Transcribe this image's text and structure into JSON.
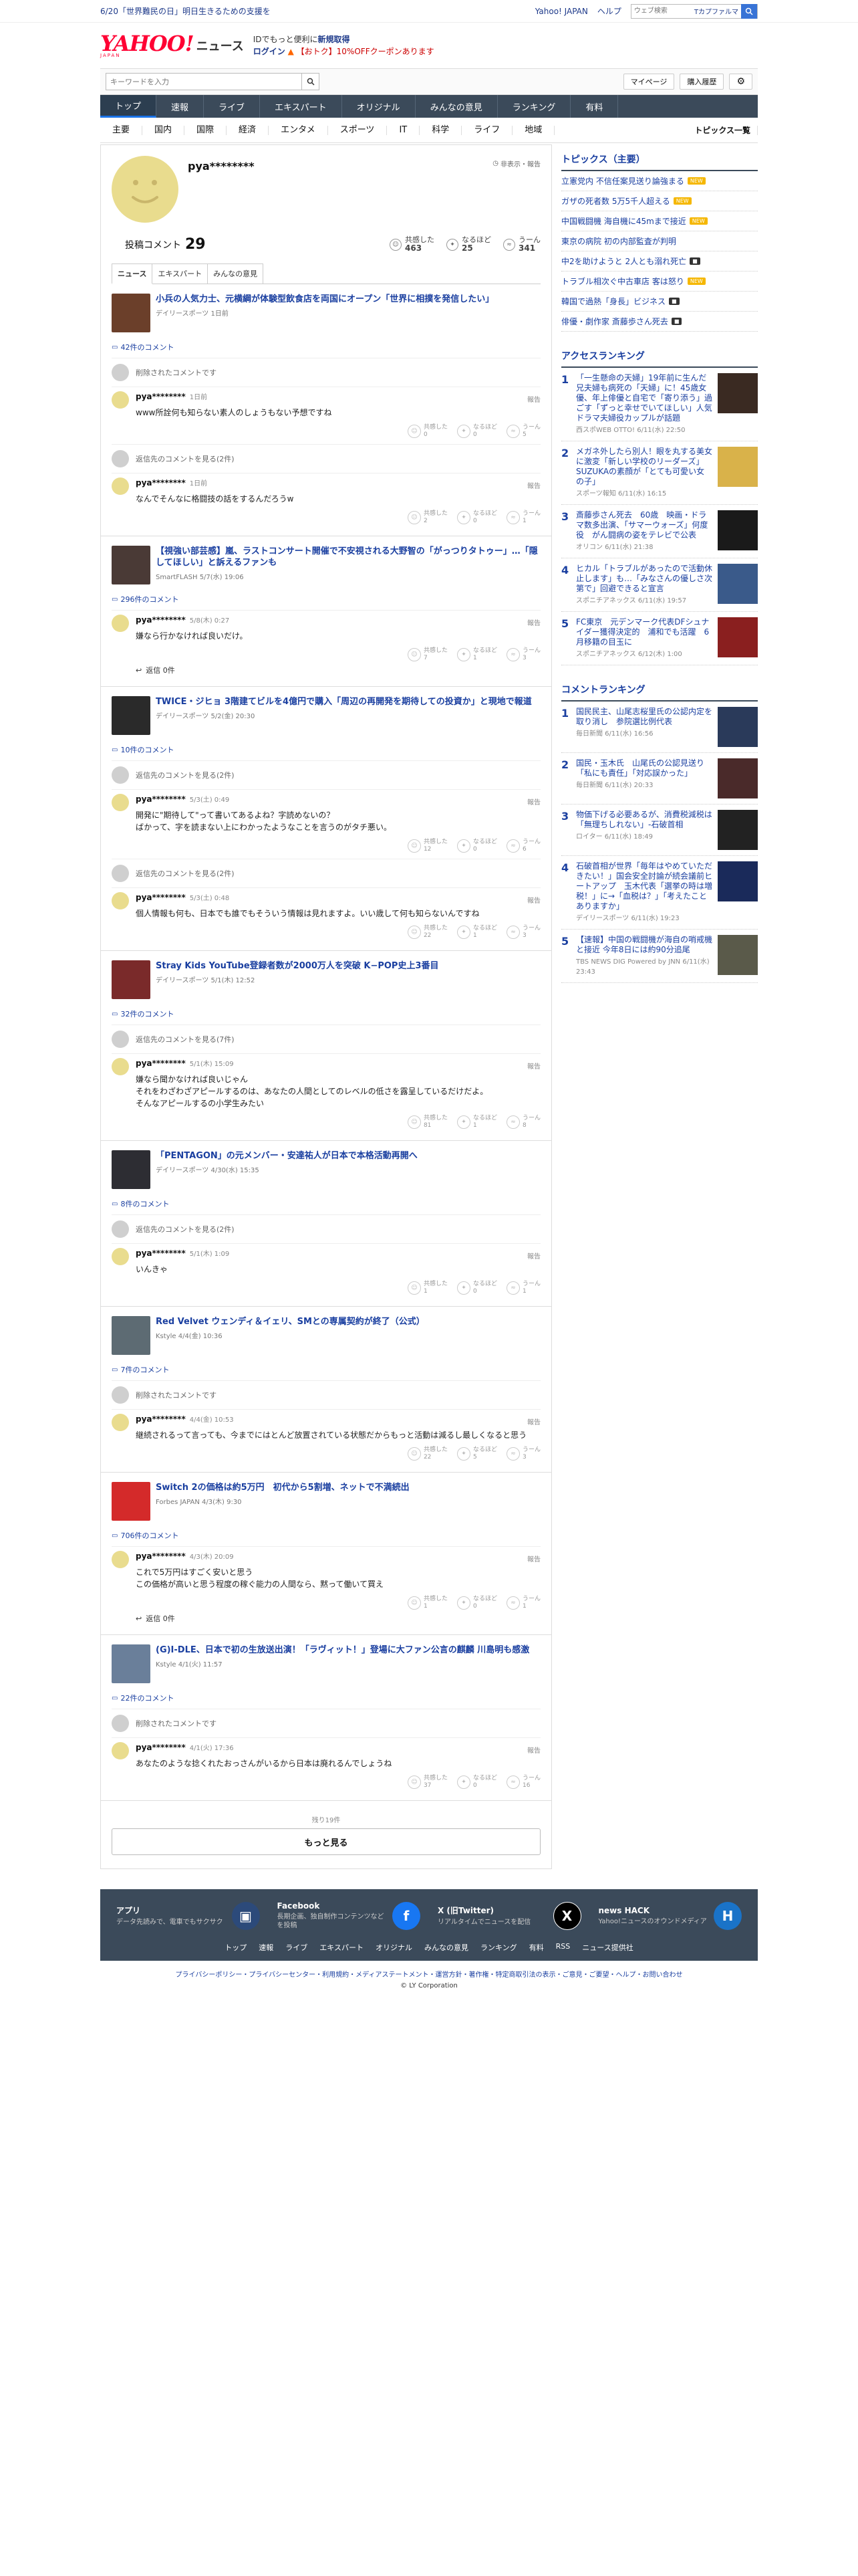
{
  "topbar": {
    "promo": "6/20「世界難民の日」明日生きるための支援を",
    "links": [
      "Yahoo! JAPAN",
      "ヘルプ"
    ],
    "search_placeholder": "ウェブ検索",
    "search_button": "Tカプファルマ"
  },
  "header": {
    "logo_yahoo": "YAHOO!",
    "logo_japan": "JAPAN",
    "logo_news": "ニュース",
    "msg1_a": "IDでもっと便利に",
    "msg1_b": "新規取得",
    "msg2_a": "ログイン",
    "msg2_b": "【おトク】10%OFFクーポンあります"
  },
  "searchbar": {
    "placeholder": "キーワードを入力",
    "mypage": "マイページ",
    "history": "購入履歴"
  },
  "gnav": [
    "トップ",
    "速報",
    "ライブ",
    "エキスパート",
    "オリジナル",
    "みんなの意見",
    "ランキング",
    "有料"
  ],
  "snav": [
    "主要",
    "国内",
    "国際",
    "経済",
    "エンタメ",
    "スポーツ",
    "IT",
    "科学",
    "ライフ",
    "地域"
  ],
  "snav_list": "トピックス一覧",
  "profile": {
    "name": "pya********",
    "hidden_note": "非表示・報告",
    "count_label": "投稿コメント",
    "count": "29",
    "reactions": [
      {
        "label": "共感した",
        "value": "463",
        "icon": "thumbs-up-icon"
      },
      {
        "label": "なるほど",
        "value": "25",
        "icon": "lightbulb-icon"
      },
      {
        "label": "うーん",
        "value": "341",
        "icon": "hmm-icon"
      }
    ]
  },
  "tabs": [
    "ニュース",
    "エキスパート",
    "みんなの意見"
  ],
  "articles": [
    {
      "title": "小兵の人気力士、元横綱が体験型飲食店を両国にオープン「世界に相撲を発信したい」",
      "source": "デイリースポーツ 1日前",
      "thumb_color": "#6b3f2a",
      "count": "42件のコメント",
      "comments": [
        {
          "type": "deleted",
          "text": "削除されたコメントです"
        },
        {
          "type": "comment",
          "user": "pya********",
          "time": "1日前",
          "text": "www所詮何も知らない素人のしょうもない予想ですね",
          "r": [
            "0",
            "0",
            "5"
          ]
        },
        {
          "type": "deleted",
          "text": "返信先のコメントを見る(2件)"
        },
        {
          "type": "comment",
          "user": "pya********",
          "time": "1日前",
          "text": "なんでそんなに格闘技の話をするんだろうw",
          "r": [
            "2",
            "0",
            "1"
          ]
        }
      ]
    },
    {
      "title": "【視強い部芸感】嵐、ラストコンサート開催で不安視される大野智の「がっつりタトゥー」…「隠してほしい」と訴えるファンも",
      "source": "SmartFLASH 5/7(水) 19:06",
      "thumb_color": "#4a3a36",
      "count": "296件のコメント",
      "comments": [
        {
          "type": "comment",
          "user": "pya********",
          "time": "5/8(木) 0:27",
          "text": "嫌なら行かなければ良いだけ。",
          "r": [
            "7",
            "1",
            "3"
          ],
          "reply": "返信 0件"
        }
      ]
    },
    {
      "title": "TWICE・ジヒョ 3階建てビルを4億円で購入「周辺の再開発を期待しての投資か」と現地で報道",
      "source": "デイリースポーツ 5/2(金) 20:30",
      "thumb_color": "#2a2a2a",
      "count": "10件のコメント",
      "comments": [
        {
          "type": "deleted",
          "text": "返信先のコメントを見る(2件)"
        },
        {
          "type": "comment",
          "user": "pya********",
          "time": "5/3(土) 0:49",
          "text": "開発に\"期待して\"って書いてあるよね？字読めないの？\nばかって、字を読まない上にわかったようなことを言うのがタチ悪い。",
          "r": [
            "12",
            "0",
            "6"
          ]
        },
        {
          "type": "deleted",
          "text": "返信先のコメントを見る(2件)"
        },
        {
          "type": "comment",
          "user": "pya********",
          "time": "5/3(土) 0:48",
          "text": "個人情報も何も、日本でも誰でもそういう情報は見れますよ。いい歳して何も知らないんですね",
          "r": [
            "22",
            "1",
            "3"
          ]
        }
      ]
    },
    {
      "title": "Stray Kids YouTube登録者数が2000万人を突破 K−POP史上3番目",
      "source": "デイリースポーツ 5/1(木) 12:52",
      "thumb_color": "#7a2a2a",
      "count": "32件のコメント",
      "comments": [
        {
          "type": "deleted",
          "text": "返信先のコメントを見る(7件)"
        },
        {
          "type": "comment",
          "user": "pya********",
          "time": "5/1(木) 15:09",
          "text": "嫌なら聞かなければ良いじゃん\nそれをわざわざアピールするのは、あなたの人間としてのレベルの低さを露呈しているだけだよ。\nそんなアピールするの小学生みたい",
          "r": [
            "81",
            "1",
            "8"
          ]
        }
      ]
    },
    {
      "title": "「PENTAGON」の元メンバー・安達祐人が日本で本格活動再開へ",
      "source": "デイリースポーツ 4/30(水) 15:35",
      "thumb_color": "#2d2d33",
      "count": "8件のコメント",
      "comments": [
        {
          "type": "deleted",
          "text": "返信先のコメントを見る(2件)"
        },
        {
          "type": "comment",
          "user": "pya********",
          "time": "5/1(木) 1:09",
          "text": "いんきゃ",
          "r": [
            "1",
            "0",
            "1"
          ]
        }
      ]
    },
    {
      "title": "Red Velvet ウェンディ＆イェリ、SMとの専属契約が終了（公式）",
      "source": "Kstyle 4/4(金) 10:36",
      "thumb_color": "#5d6b73",
      "count": "7件のコメント",
      "comments": [
        {
          "type": "deleted",
          "text": "削除されたコメントです"
        },
        {
          "type": "comment",
          "user": "pya********",
          "time": "4/4(金) 10:53",
          "text": "継続されるって言っても、今までにはとんど放置されている状態だからもっと活動は減るし最しくなると思う",
          "r": [
            "22",
            "5",
            "3"
          ]
        }
      ]
    },
    {
      "title": "Switch 2の価格は約5万円　初代から5割増、ネットで不満続出",
      "source": "Forbes JAPAN 4/3(木) 9:30",
      "thumb_color": "#d42a2a",
      "count": "706件のコメント",
      "comments": [
        {
          "type": "comment",
          "user": "pya********",
          "time": "4/3(木) 20:09",
          "text": "これで5万円はすごく安いと思う\nこの価格が高いと思う程度の稼ぐ能力の人間なら、黙って働いて買え",
          "r": [
            "1",
            "0",
            "1"
          ],
          "reply": "返信 0件"
        }
      ]
    },
    {
      "title": "(G)I-DLE、日本で初の生放送出演！「ラヴィット！」登場に大ファン公言の麒麟 川島明も感激",
      "source": "Kstyle 4/1(火) 11:57",
      "thumb_color": "#6a7f9a",
      "count": "22件のコメント",
      "comments": [
        {
          "type": "deleted",
          "text": "削除されたコメントです"
        },
        {
          "type": "comment",
          "user": "pya********",
          "time": "4/1(火) 17:36",
          "text": "あなたのような捻くれたおっさんがいるから日本は廃れるんでしょうね",
          "r": [
            "37",
            "0",
            "16"
          ]
        }
      ]
    }
  ],
  "more": {
    "rest": "残り19件",
    "button": "もっと見る"
  },
  "sidebar": {
    "topics_title": "トピックス（主要）",
    "topics": [
      {
        "text": "立憲党内 不信任案見送り論強まる",
        "badge": "NEW"
      },
      {
        "text": "ガザの死者数 5万5千人超える",
        "badge": "NEW"
      },
      {
        "text": "中国戦闘機 海自機に45mまで接近",
        "badge": "NEW"
      },
      {
        "text": "東京の病院 初の内部監査が判明",
        "badge": ""
      },
      {
        "text": "中2を助けようと 2人とも溺れ死亡",
        "badge": "■"
      },
      {
        "text": "トラブル相次ぐ中古車店 客は怒り",
        "badge": "NEW"
      },
      {
        "text": "韓国で過熱「身長」ビジネス",
        "badge": "■"
      },
      {
        "text": "俳優・劇作家 斎藤歩さん死去",
        "badge": "■"
      }
    ],
    "access_title": "アクセスランキング",
    "access": [
      {
        "no": "1",
        "text": "「一生懸命の天婦」19年前に生んだ兄夫婦も病死の「天婦」に！45歳女優、年上俳優と自宅で「寄り添う」過ごす「ずっと幸せでいてほしい」人気ドラマ夫婦役カップルが話題",
        "src": "西スポWEB OTTO!  6/11(水) 22:50",
        "color": "#3a2a22"
      },
      {
        "no": "2",
        "text": "メガネ外したら別人！眼を丸する美女に激変「新しい学校のリーダーズ」SUZUKAの素顔が「とても可愛い女の子」",
        "src": "スポーツ報知  6/11(水) 16:15",
        "color": "#d9b24a"
      },
      {
        "no": "3",
        "text": "斎藤歩さん死去　60歳　映画・ドラマ数多出演、「サマーウォーズ」何度役　がん闘病の姿をテレビで公表",
        "src": "オリコン  6/11(水) 21:38",
        "color": "#1a1a1a"
      },
      {
        "no": "4",
        "text": "ヒカル「トラブルがあったので活動休止します」も…「みなさんの優しさ次第で」回避できると宣言",
        "src": "スポニチアネックス  6/11(水) 19:57",
        "color": "#3a5a8a"
      },
      {
        "no": "5",
        "text": "FC東京　元デンマーク代表DFシュナイダー獲得決定的　浦和でも活躍　6月移籍の目玉に",
        "src": "スポニチアネックス  6/12(木) 1:00",
        "color": "#8a1f1f"
      }
    ],
    "comment_title": "コメントランキング",
    "comments": [
      {
        "no": "1",
        "text": "国民民主、山尾志桜里氏の公認内定を取り消し　参院選比例代表",
        "src": "毎日新聞  6/11(水) 16:56",
        "color": "#2a3a5a"
      },
      {
        "no": "2",
        "text": "国民・玉木氏　山尾氏の公認見送り「私にも責任」「対応誤かった」",
        "src": "毎日新聞  6/11(水) 20:33",
        "color": "#4a2a2a"
      },
      {
        "no": "3",
        "text": "物価下げる必要あるが、消費税減税は「無理ちしれない」-石破首相",
        "src": "ロイター  6/11(水) 18:49",
        "color": "#222222"
      },
      {
        "no": "4",
        "text": "石破首相が世界「毎年はやめていただきたい！」国会安全討論が続会議前ヒートアップ　玉木代表「選挙の時は増税！」に→「血税は？」「考えたことありますか」",
        "src": "デイリースポーツ  6/11(水) 19:23",
        "color": "#1a2a5a"
      },
      {
        "no": "5",
        "text": "【速報】中国の戦闘機が海自の哨戒機と接近 今年8日には約90分追尾",
        "src": "TBS NEWS DIG Powered by JNN  6/11(水) 23:43",
        "color": "#5a5a4a"
      }
    ]
  },
  "footer": {
    "apps": [
      {
        "name": "アプリ",
        "desc": "データ先読みで、電車でもサクサク",
        "icon": "app-icon",
        "color": "#2c4a7a"
      },
      {
        "name": "Facebook",
        "desc": "長期企画、独自制作コンテンツなどを投稿",
        "icon": "facebook-icon",
        "color": "#1877f2"
      },
      {
        "name": "X (旧Twitter)",
        "desc": "リアルタイムでニュースを配信",
        "icon": "x-icon",
        "color": "#000000"
      },
      {
        "name": "news HACK",
        "desc": "Yahoo!ニュースのオウンドメディア",
        "icon": "newshack-icon",
        "color": "#1a73c8"
      }
    ],
    "nav": [
      "トップ",
      "速報",
      "ライブ",
      "エキスパート",
      "オリジナル",
      "みんなの意見",
      "ランキング",
      "有料",
      "RSS",
      "ニュース提供社"
    ],
    "legal": "プライバシーポリシー・プライバシーセンター・利用規約・メディアステートメント・運営方針・著作権・特定商取引法の表示・ご意見・ご要望・ヘルプ・お問い合わせ",
    "copyright": "© LY Corporation"
  }
}
